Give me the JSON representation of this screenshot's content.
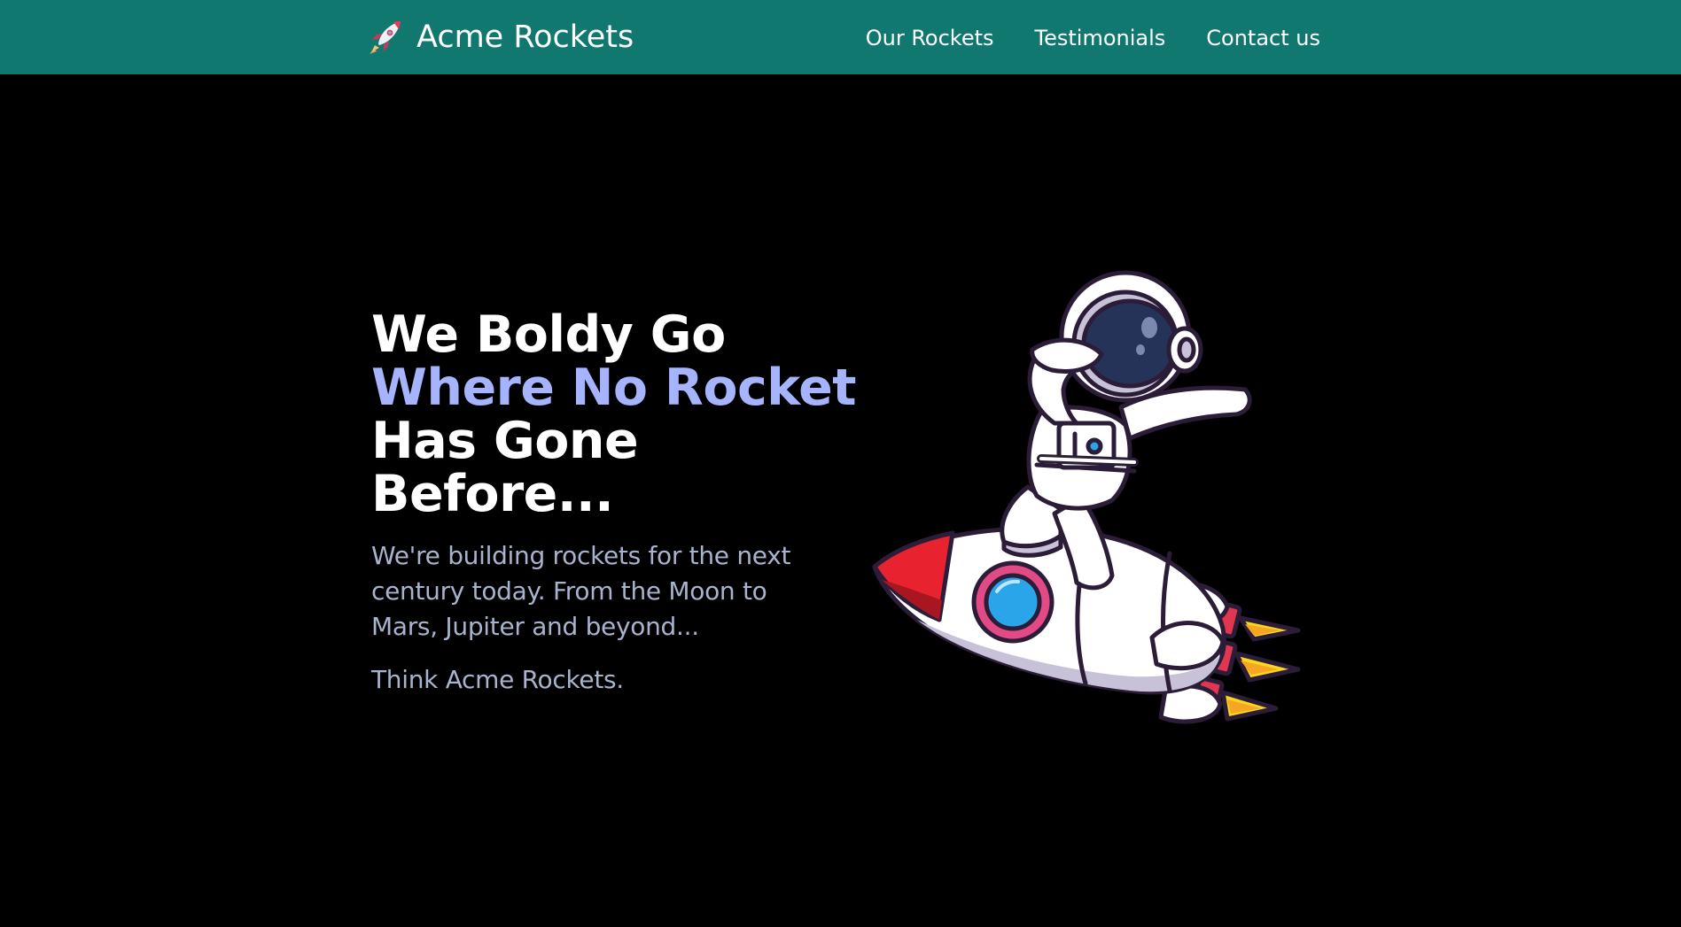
{
  "header": {
    "brand_name": "Acme Rockets",
    "brand_icon": "rocket-icon",
    "nav": [
      {
        "label": "Our Rockets"
      },
      {
        "label": "Testimonials"
      },
      {
        "label": "Contact us"
      }
    ]
  },
  "hero": {
    "title_line1": "We Boldy Go",
    "title_line2": "Where No Rocket",
    "title_line3": "Has Gone",
    "title_line4": "Before...",
    "description": "We're building rockets for the next century today. From the Moon to Mars, Jupiter and beyond...",
    "tagline": "Think Acme Rockets.",
    "illustration": "astronaut-riding-rocket-image"
  },
  "colors": {
    "header_bg": "#117870",
    "page_bg": "#000000",
    "accent": "#a5b4fc",
    "body_text": "#a8b4cd"
  }
}
